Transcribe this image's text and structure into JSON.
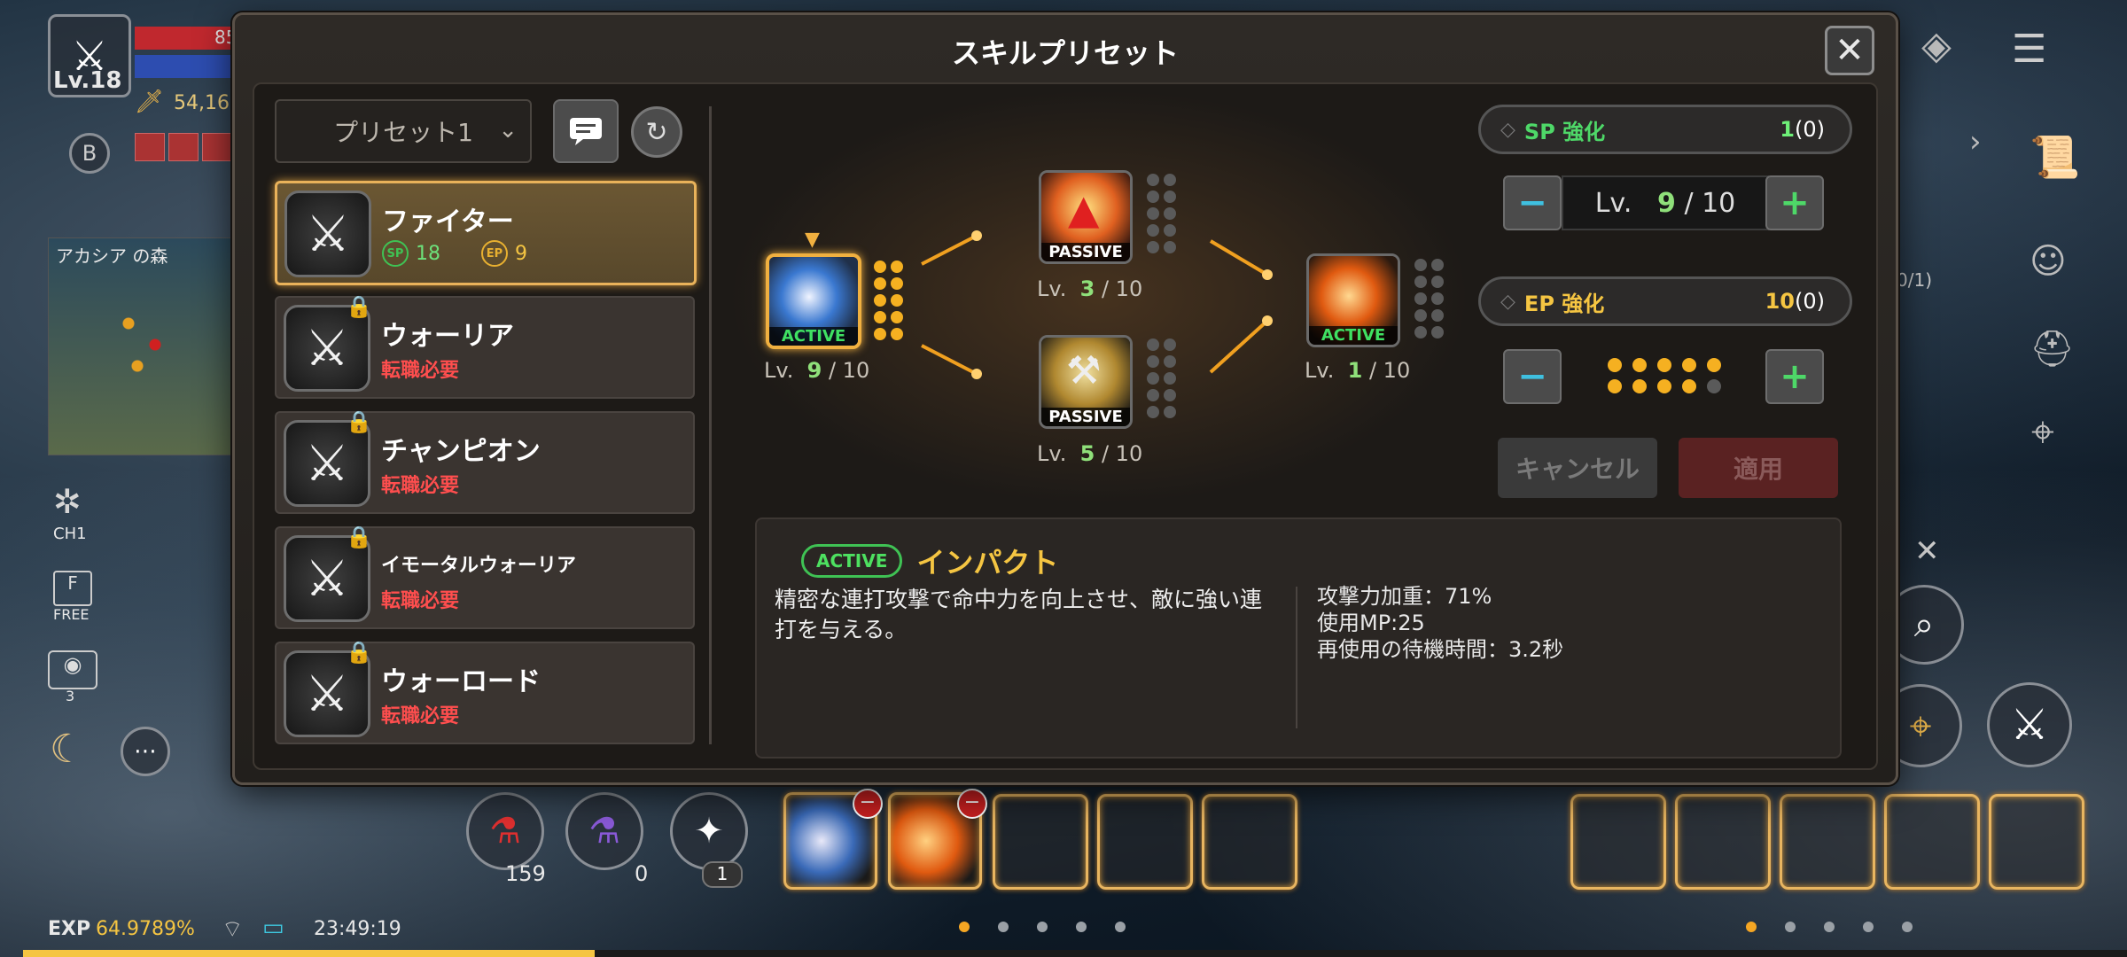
{
  "hud": {
    "player_level": "Lv.18",
    "hp_value": "85",
    "power": "54,16",
    "zone_name": "アカシア の森",
    "channel": "CH1",
    "free_label": "FREE",
    "camera_count": "3",
    "side_counter": "0/1)",
    "exp_label": "EXP",
    "exp_value": "64.9789%",
    "exp_fraction": 0.6498,
    "clock": "23:49:19",
    "items": [
      {
        "icon": "red-potion-icon",
        "count": "159"
      },
      {
        "icon": "purple-potion-icon",
        "count": "0"
      },
      {
        "icon": "return-scroll-icon",
        "count": "1"
      }
    ]
  },
  "modal": {
    "title": "スキルプリセット",
    "close_icon": "close-icon",
    "preset": {
      "selected": "プリセット1"
    },
    "classes": [
      {
        "name": "ファイター",
        "sp_label": "SP",
        "sp": "18",
        "ep_label": "EP",
        "ep": "9",
        "selected": true,
        "locked": false
      },
      {
        "name": "ウォーリア",
        "status": "転職必要",
        "locked": true
      },
      {
        "name": "チャンピオン",
        "status": "転職必要",
        "locked": true
      },
      {
        "name": "イモータルウォーリア",
        "status": "転職必要",
        "locked": true
      },
      {
        "name": "ウォーロード",
        "status": "転職必要",
        "locked": true
      }
    ],
    "skills": [
      {
        "type": "ACTIVE",
        "lv_prefix": "Lv.",
        "lv": "9",
        "max": "/ 10",
        "pips_on": 10,
        "pips_total": 10
      },
      {
        "type": "PASSIVE",
        "lv_prefix": "Lv.",
        "lv": "3",
        "max": "/ 10",
        "pips_on": 0,
        "pips_total": 10
      },
      {
        "type": "PASSIVE",
        "lv_prefix": "Lv.",
        "lv": "5",
        "max": "/ 10",
        "pips_on": 0,
        "pips_total": 10
      },
      {
        "type": "ACTIVE",
        "lv_prefix": "Lv.",
        "lv": "1",
        "max": "/ 10",
        "pips_on": 0,
        "pips_total": 10
      }
    ],
    "sp_enhance": {
      "label": "SP 強化",
      "value": "1",
      "extra": "(0)"
    },
    "lv_control": {
      "prefix": "Lv.",
      "current": "9",
      "max": "/ 10",
      "minus": "−",
      "plus": "+"
    },
    "ep_enhance": {
      "label": "EP 強化",
      "value": "10",
      "extra": "(0)",
      "dots_on": 9,
      "dots_total": 10
    },
    "cancel_label": "キャンセル",
    "apply_label": "適用",
    "description": {
      "tag": "ACTIVE",
      "name": "インパクト",
      "text": "精密な連打攻撃で命中力を向上させ、敵に強い連打を与える。",
      "stats": [
        "攻撃力加重：71%",
        "使用MP:25",
        "再使用の待機時間：3.2秒"
      ]
    }
  },
  "colors": {
    "accent": "#f0b040",
    "active_green": "#3fe062",
    "locked_red": "#ff4e4e",
    "sp_green": "#4ed868",
    "ep_yellow": "#f5c542"
  }
}
